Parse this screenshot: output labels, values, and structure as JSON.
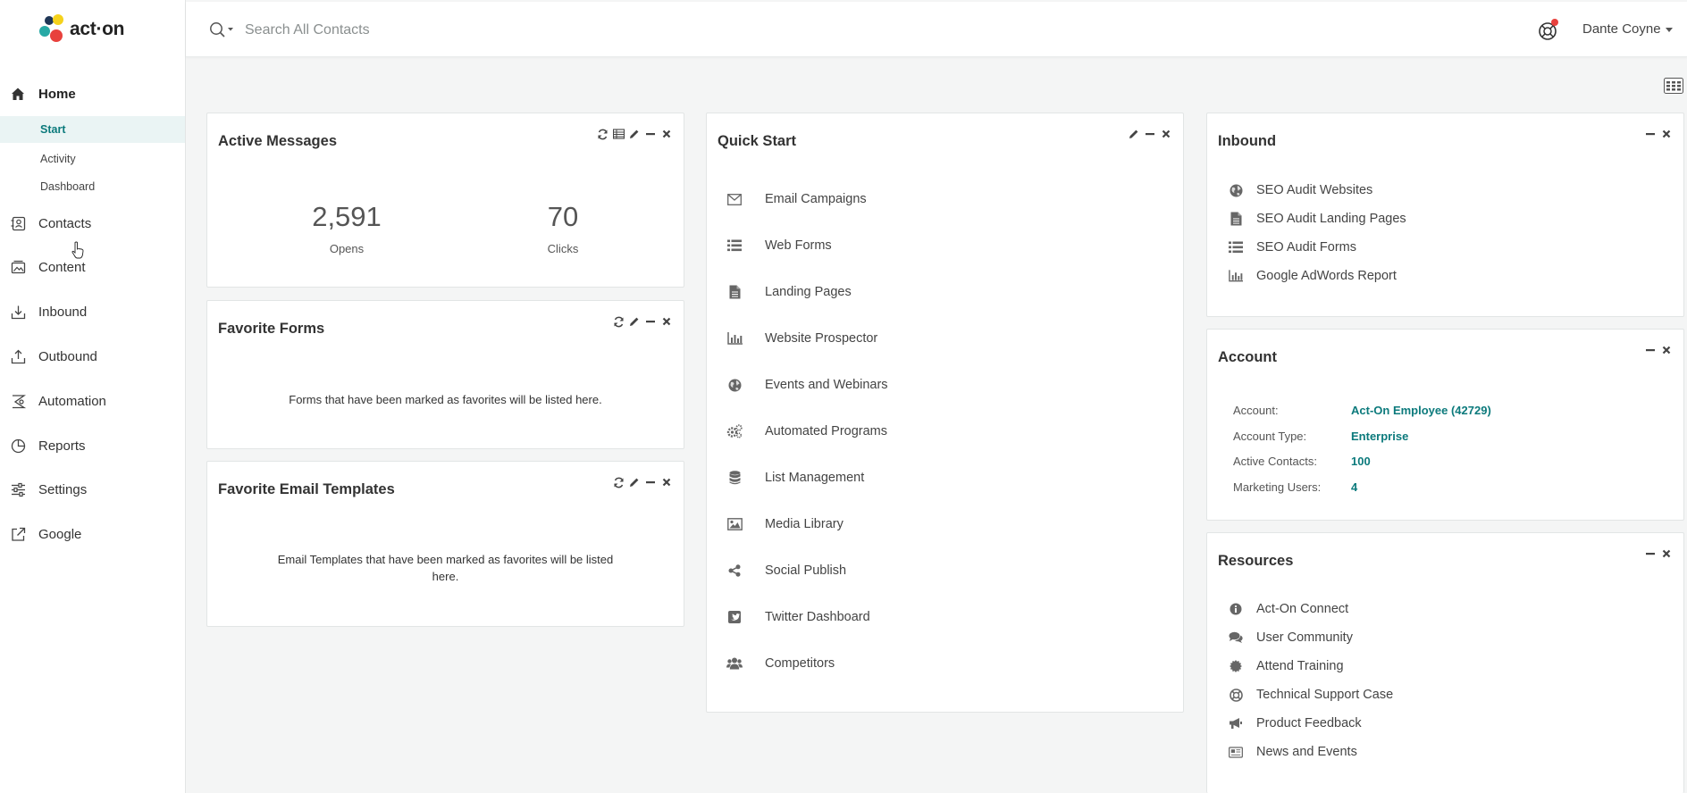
{
  "colors": {
    "accent": "#0c7a7c",
    "help_dot": "#e8413d",
    "logo_yellow": "#f5d21c",
    "logo_teal": "#27a9a5",
    "logo_red": "#e8413d",
    "logo_navy": "#1f3656"
  },
  "logo": {
    "text": "act·on"
  },
  "sidebar": {
    "home": {
      "label": "Home",
      "icon": "home-icon"
    },
    "sub_items": [
      {
        "label": "Start",
        "active": true
      },
      {
        "label": "Activity",
        "active": false
      },
      {
        "label": "Dashboard",
        "active": false
      }
    ],
    "items": [
      {
        "label": "Contacts",
        "icon": "contacts-icon"
      },
      {
        "label": "Content",
        "icon": "content-icon"
      },
      {
        "label": "Inbound",
        "icon": "inbound-icon"
      },
      {
        "label": "Outbound",
        "icon": "outbound-icon"
      },
      {
        "label": "Automation",
        "icon": "automation-icon"
      },
      {
        "label": "Reports",
        "icon": "reports-icon"
      },
      {
        "label": "Settings",
        "icon": "settings-icon"
      },
      {
        "label": "Google",
        "icon": "external-link-icon"
      }
    ]
  },
  "topbar": {
    "search_placeholder": "Search All Contacts",
    "user_name": "Dante Coyne",
    "help_icon": "help-lifebuoy-icon"
  },
  "active_messages": {
    "title": "Active Messages",
    "opens_value": "2,591",
    "opens_label": "Opens",
    "clicks_value": "70",
    "clicks_label": "Clicks"
  },
  "favorite_forms": {
    "title": "Favorite Forms",
    "empty_message": "Forms that have been marked as favorites will be listed here."
  },
  "favorite_email_templates": {
    "title": "Favorite Email Templates",
    "empty_message": "Email Templates that have been marked as favorites will be listed here."
  },
  "quick_start": {
    "title": "Quick Start",
    "items": [
      {
        "label": "Email Campaigns",
        "icon": "envelope-icon"
      },
      {
        "label": "Web Forms",
        "icon": "list-icon"
      },
      {
        "label": "Landing Pages",
        "icon": "document-icon"
      },
      {
        "label": "Website Prospector",
        "icon": "bar-chart-icon"
      },
      {
        "label": "Events and Webinars",
        "icon": "globe-icon"
      },
      {
        "label": "Automated Programs",
        "icon": "gears-icon"
      },
      {
        "label": "List Management",
        "icon": "database-icon"
      },
      {
        "label": "Media Library",
        "icon": "image-icon"
      },
      {
        "label": "Social Publish",
        "icon": "share-icon"
      },
      {
        "label": "Twitter Dashboard",
        "icon": "twitter-icon"
      },
      {
        "label": "Competitors",
        "icon": "users-icon"
      }
    ]
  },
  "inbound": {
    "title": "Inbound",
    "items": [
      {
        "label": "SEO Audit Websites",
        "icon": "globe-icon"
      },
      {
        "label": "SEO Audit Landing Pages",
        "icon": "document-icon"
      },
      {
        "label": "SEO Audit Forms",
        "icon": "list-icon"
      },
      {
        "label": "Google AdWords Report",
        "icon": "bar-chart-icon"
      }
    ]
  },
  "account": {
    "title": "Account",
    "rows": [
      {
        "key": "Account:",
        "value": "Act-On Employee (42729)"
      },
      {
        "key": "Account Type:",
        "value": "Enterprise"
      },
      {
        "key": "Active Contacts:",
        "value": "100"
      },
      {
        "key": "Marketing Users:",
        "value": "4"
      }
    ]
  },
  "resources": {
    "title": "Resources",
    "items": [
      {
        "label": "Act-On Connect",
        "icon": "info-icon"
      },
      {
        "label": "User Community",
        "icon": "comments-icon"
      },
      {
        "label": "Attend Training",
        "icon": "certificate-icon"
      },
      {
        "label": "Technical Support Case",
        "icon": "lifebuoy-icon"
      },
      {
        "label": "Product Feedback",
        "icon": "bullhorn-icon"
      },
      {
        "label": "News and Events",
        "icon": "newspaper-icon"
      }
    ]
  }
}
